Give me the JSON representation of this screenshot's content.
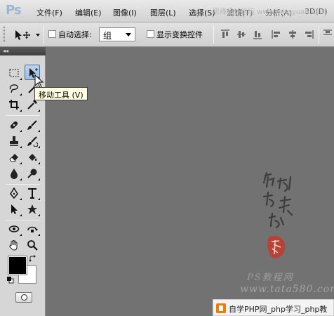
{
  "app": {
    "logo": "Ps"
  },
  "menu": {
    "items": [
      "文件(F)",
      "编辑(E)",
      "图像(I)",
      "图层(L)",
      "选择(S)",
      "滤镜(T)",
      "分析(A)",
      "3D(D)"
    ]
  },
  "watermark_top": "思缘设计论坛 www.missyuan.com",
  "options_bar": {
    "tool_preset_icon": "move-arrows-icon",
    "auto_select_label": "自动选择:",
    "auto_select_value": "组",
    "show_transform_label": "显示变换控件"
  },
  "toolbox": {
    "collapse_glyph": "◂◂",
    "tools": [
      "rectangular-marquee-icon",
      "move-icon",
      "lasso-icon",
      "magic-wand-icon",
      "crop-icon",
      "eyedropper-icon",
      "spot-healing-icon",
      "brush-icon",
      "clone-stamp-icon",
      "history-brush-icon",
      "eraser-icon",
      "paint-bucket-icon",
      "blur-icon",
      "dodge-icon",
      "pen-icon",
      "type-icon",
      "path-selection-icon",
      "custom-shape-icon",
      "3d-rotate-icon",
      "3d-orbit-icon",
      "hand-icon",
      "zoom-icon"
    ],
    "foreground_color": "#000000",
    "background_color": "#ffffff"
  },
  "tooltip": {
    "text": "移动工具 (V)"
  },
  "canvas": {
    "background": "#727272",
    "watermark_site": "PS教程网",
    "watermark_url": "www.tata580.com"
  },
  "footer_badge": {
    "text": "自学PHP网_php学习_php教"
  }
}
